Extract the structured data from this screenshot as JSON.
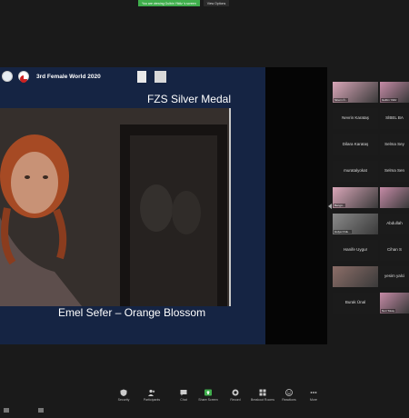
{
  "share_bar": {
    "notice": "You are viewing Gulbin Yildiz 's screen",
    "view_options": "View Options"
  },
  "slide": {
    "title": "3rd Female World 2020",
    "award": "FZS Silver Medal",
    "caption": "Emel Sefer – Orange Blossom"
  },
  "participants": [
    {
      "name": "",
      "tag": "Sinem Ö...",
      "type": "video"
    },
    {
      "name": "",
      "tag": "Gulbin Yildiz",
      "type": "video"
    },
    {
      "name": "Nevrin Karataş",
      "type": "name"
    },
    {
      "name": "SİBEL BA",
      "type": "name"
    },
    {
      "name": "Dilara Karataş",
      "type": "name"
    },
    {
      "name": "Selma Sey",
      "type": "name"
    },
    {
      "name": "muratalyokat",
      "type": "name"
    },
    {
      "name": "Selma Sen",
      "type": "name"
    },
    {
      "name": "",
      "tag": "Bengü...",
      "type": "video"
    },
    {
      "name": "",
      "tag": "",
      "type": "video"
    },
    {
      "name": "",
      "tag": "Hulya Ordu...",
      "type": "video"
    },
    {
      "name": "Abdullah",
      "type": "name"
    },
    {
      "name": "Hanife Uygur",
      "type": "name"
    },
    {
      "name": "Cihan S",
      "type": "name"
    },
    {
      "name": "",
      "tag": "",
      "type": "video"
    },
    {
      "name": "yesim yalci",
      "type": "name"
    },
    {
      "name": "Burak Ünal",
      "type": "name"
    },
    {
      "name": "",
      "tag": "Nuri Tokay",
      "type": "video"
    }
  ],
  "toolbar": [
    {
      "label": "Security",
      "icon": "shield-icon"
    },
    {
      "label": "Participants",
      "icon": "participants-icon"
    },
    {
      "label": "Chat",
      "icon": "chat-icon"
    },
    {
      "label": "Share Screen",
      "icon": "share-screen-icon"
    },
    {
      "label": "Record",
      "icon": "record-icon"
    },
    {
      "label": "Breakout Rooms",
      "icon": "breakout-rooms-icon"
    },
    {
      "label": "Reactions",
      "icon": "reactions-icon"
    },
    {
      "label": "More",
      "icon": "more-icon"
    }
  ],
  "colors": {
    "accent_green": "#3fae4c",
    "slide_background": "#152443",
    "background": "#1a1a1a"
  }
}
